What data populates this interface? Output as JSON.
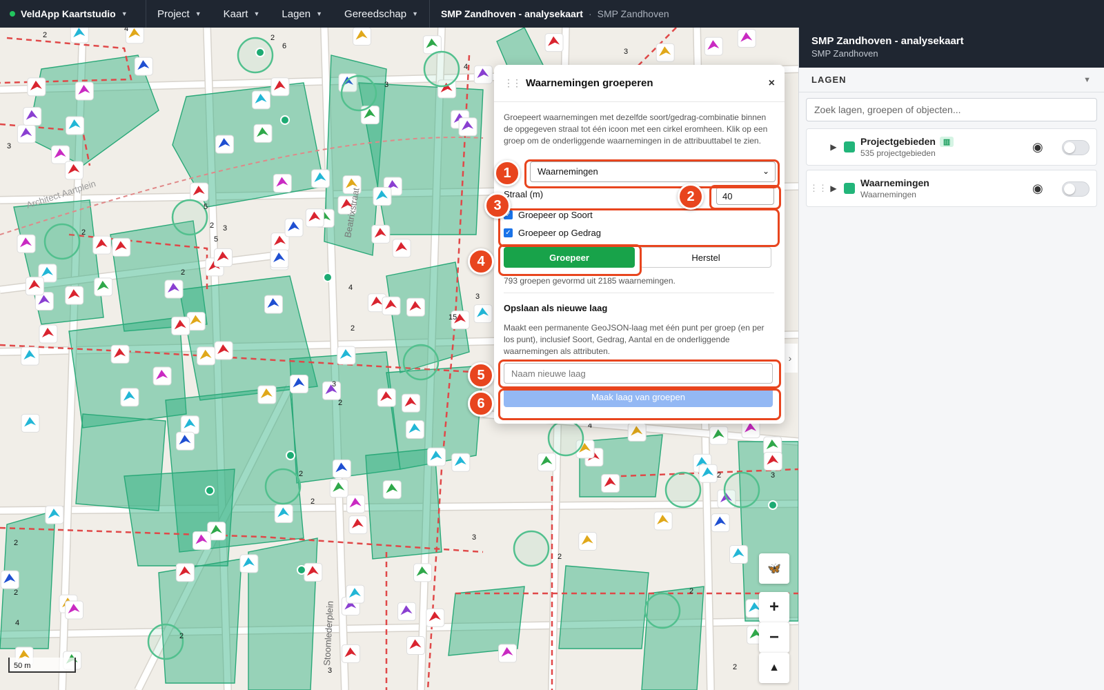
{
  "topbar": {
    "brand": "VeldApp Kaartstudio",
    "menus": [
      "Project",
      "Kaart",
      "Lagen",
      "Gereedschap"
    ],
    "title": "SMP Zandhoven - analysekaart",
    "subtitle": "SMP Zandhoven"
  },
  "map": {
    "street_labels": [
      "Beatrixstraat",
      "Architect Aartplein",
      "Stoomlederplein"
    ],
    "scale_label": "50 m",
    "cluster_counts": [
      "2",
      "4",
      "6",
      "2",
      "3",
      "4",
      "3",
      "5",
      "2",
      "3",
      "5",
      "2",
      "2",
      "4",
      "15",
      "3",
      "2",
      "3",
      "2",
      "2",
      "2",
      "4",
      "2",
      "3",
      "3",
      "2",
      "2",
      "2",
      "2",
      "4",
      "2",
      "3",
      "2",
      "3"
    ],
    "controls": {
      "zoom_in": "+",
      "zoom_out": "−",
      "compass": "▲",
      "layers_icon": "🦋",
      "collapse": "›"
    }
  },
  "dialog": {
    "title": "Waarnemingen groeperen",
    "close": "×",
    "description": "Groepeert waarnemingen met dezelfde soort/gedrag-combinatie binnen de opgegeven straal tot één icoon met een cirkel eromheen. Klik op een groep om de onderliggende waarnemingen in de attribuuttabel te zien.",
    "layer_select_value": "Waarnemingen",
    "radius_label": "Straal (m)",
    "radius_value": "40",
    "group_by_species": "Groepeer op Soort",
    "group_by_behaviour": "Groepeer op Gedrag",
    "group_button": "Groepeer",
    "reset_button": "Herstel",
    "status": "793 groepen gevormd uit 2185 waarnemingen.",
    "save_title": "Opslaan als nieuwe laag",
    "save_description": "Maakt een permanente GeoJSON-laag met één punt per groep (en per los punt), inclusief Soort, Gedrag, Aantal en de onderliggende waarnemingen als attributen.",
    "new_layer_placeholder": "Naam nieuwe laag",
    "create_layer_button": "Maak laag van groepen"
  },
  "annotations": [
    "1",
    "2",
    "3",
    "4",
    "5",
    "6"
  ],
  "panel": {
    "title": "SMP Zandhoven - analysekaart",
    "subtitle": "SMP Zandhoven",
    "section": "LAGEN",
    "search_placeholder": "Zoek lagen, groepen of objecten...",
    "layers": [
      {
        "name": "Projectgebieden",
        "count": "535 projectgebieden"
      },
      {
        "name": "Waarnemingen",
        "count": "Waarnemingen"
      }
    ]
  },
  "colors": {
    "accent": "#18a34a",
    "annotation": "#e8451e",
    "polygon": "#2bb07f",
    "route": "#e04848",
    "topbar": "#1f2631"
  }
}
